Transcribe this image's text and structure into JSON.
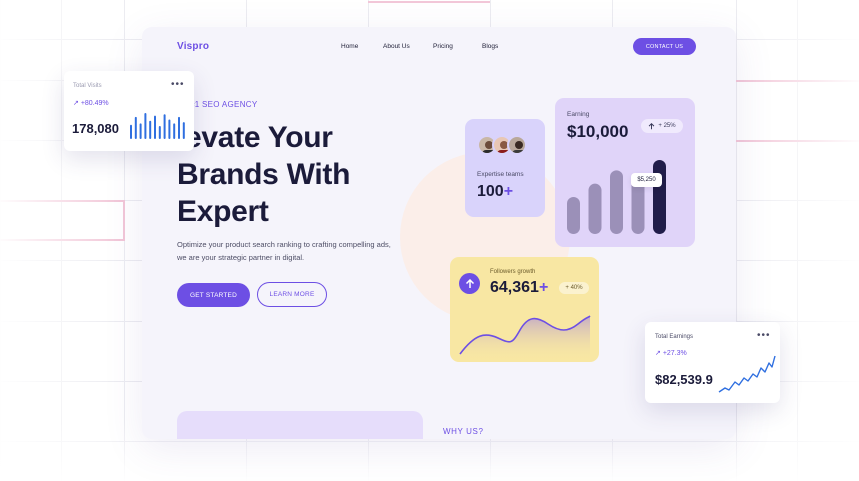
{
  "nav": {
    "logo": "Vispro",
    "links": [
      "Home",
      "About Us",
      "Pricing",
      "Blogs"
    ],
    "contact_label": "CONTACT US"
  },
  "hero": {
    "badge": "#1 SEO AGENCY",
    "headline_lines": [
      "levate Your",
      "Brands With",
      "Expert"
    ],
    "description_lines": [
      "Optimize your product search ranking to crafting compelling ads,",
      "we are your strategic partner in digital."
    ],
    "cta_primary": "GET STARTED",
    "cta_secondary": "LEARN MORE"
  },
  "team_card": {
    "label": "Expertise teams",
    "value": "100",
    "suffix": "+"
  },
  "earning_card": {
    "label": "Earning",
    "value": "$10,000",
    "change": "+ 25%",
    "tooltip": "$5,250",
    "bars": [
      0.5,
      0.68,
      0.86,
      0.8,
      1.0
    ]
  },
  "followers_card": {
    "label": "Followers growth",
    "value": "64,361",
    "suffix": "+",
    "change": "+ 40%"
  },
  "visits_card": {
    "title": "Total Visits",
    "change": "+80.49%",
    "value": "178,080",
    "bars": [
      0.55,
      0.85,
      0.6,
      1.0,
      0.7,
      0.9,
      0.5,
      0.95,
      0.75,
      0.6,
      0.85,
      0.65
    ]
  },
  "total_earnings_card": {
    "title": "Total Earnings",
    "change": "+27.3%",
    "value": "$82,539.9"
  },
  "section": {
    "why_us": "WHY US?"
  },
  "colors": {
    "accent": "#6d4fe4",
    "navy": "#1b1b3a",
    "earning_bg": "#e0d4f9",
    "team_bg": "#d9d3fb",
    "followers_bg": "#f8e7a3",
    "bar_gray": "#9b90b8",
    "bar_dark": "#211d4a",
    "bar_blue": "#2f6fe0"
  },
  "icons": {
    "more": "more-dots-icon",
    "trend": "trend-up-icon",
    "followers": "arrow-up-icon"
  }
}
